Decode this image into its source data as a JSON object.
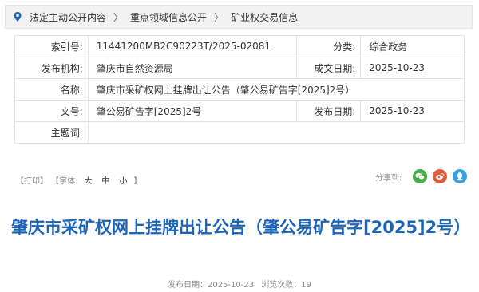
{
  "breadcrumb": {
    "items": [
      "法定主动公开内容",
      "重点领域信息公开",
      "矿业权交易信息"
    ],
    "separator": "〉"
  },
  "meta": {
    "index_label": "索引号:",
    "index_value": "11441200MB2C90223T/2025-02081",
    "category_label": "分类:",
    "category_value": "综合政务",
    "publisher_label": "发布机构:",
    "publisher_value": "肇庆市自然资源局",
    "created_label": "成文日期:",
    "created_value": "2025-10-23",
    "name_label": "名称:",
    "name_value": "肇庆市采矿权网上挂牌出让公告（肇公易矿告字[2025]2号）",
    "docno_label": "文号:",
    "docno_value": "肇公易矿告字[2025]2号",
    "pubdate_label": "发布日期:",
    "pubdate_value": "2025-10-23",
    "subject_label": "主题词:",
    "subject_value": ""
  },
  "tools": {
    "print": "【打印】",
    "font_label": "【字体:",
    "size_large": "大",
    "size_medium": "中",
    "size_small": "小",
    "font_close": "】"
  },
  "share": {
    "label": "分享到:",
    "icons": [
      "wechat-icon",
      "weibo-icon",
      "qq-icon"
    ],
    "colors": {
      "wechat": "#46b04a",
      "weibo": "#e35a3a",
      "qq": "#3a9fe0"
    }
  },
  "article": {
    "title": "肇庆市采矿权网上挂牌出让公告（肇公易矿告字[2025]2号）",
    "pub_label": "发布日期：",
    "pub_date": "2025-10-23",
    "views_label": "浏览次数：",
    "views": "19"
  },
  "colors": {
    "accent": "#1b64b8",
    "border": "#e3e3e3"
  }
}
